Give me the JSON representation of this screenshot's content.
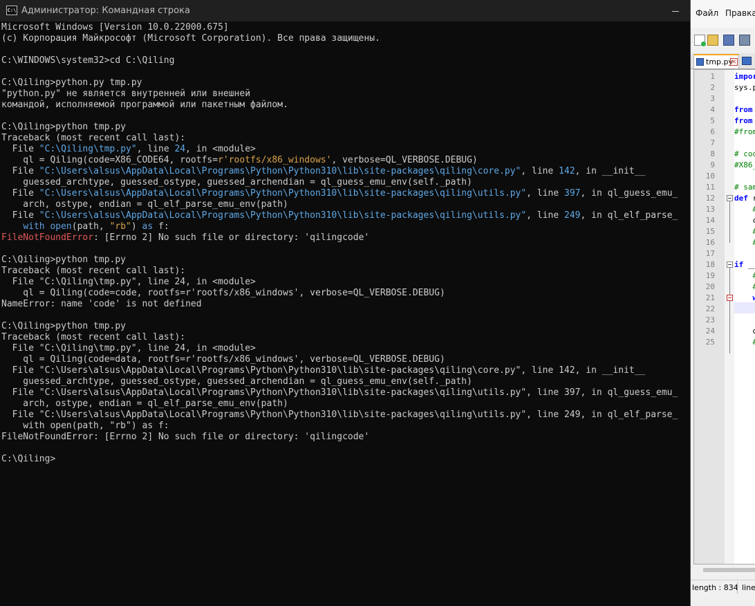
{
  "cmd": {
    "title": "Администратор: Командная строка",
    "icon": "cmd-icon",
    "lines": [
      [
        {
          "t": "Microsoft Windows [Version 10.0.22000.675]",
          "c": ""
        }
      ],
      [
        {
          "t": "(c) Корпорация Майкрософт (Microsoft Corporation). Все права защищены.",
          "c": ""
        }
      ],
      [],
      [
        {
          "t": "C:\\WINDOWS\\system32>cd C:\\Qiling",
          "c": ""
        }
      ],
      [],
      [
        {
          "t": "C:\\Qiling>python.py tmp.py",
          "c": ""
        }
      ],
      [
        {
          "t": "\"python.py\" не является внутренней или внешней",
          "c": ""
        }
      ],
      [
        {
          "t": "командой, исполняемой программой или пакетным файлом.",
          "c": ""
        }
      ],
      [],
      [
        {
          "t": "C:\\Qiling>python tmp.py",
          "c": ""
        }
      ],
      [
        {
          "t": "Traceback (most recent call last):",
          "c": ""
        }
      ],
      [
        {
          "t": "  File ",
          "c": ""
        },
        {
          "t": "\"C:\\Qiling\\tmp.py\"",
          "c": "p"
        },
        {
          "t": ", line ",
          "c": ""
        },
        {
          "t": "24",
          "c": "n"
        },
        {
          "t": ", in <module>",
          "c": ""
        }
      ],
      [
        {
          "t": "    ql = Qiling(code=X86_CODE64, rootfs=",
          "c": ""
        },
        {
          "t": "r'rootfs/x86_windows'",
          "c": "s"
        },
        {
          "t": ", verbose=QL_VERBOSE.DEBUG)",
          "c": ""
        }
      ],
      [
        {
          "t": "  File ",
          "c": ""
        },
        {
          "t": "\"C:\\Users\\alsus\\AppData\\Local\\Programs\\Python\\Python310\\lib\\site-packages\\qiling\\core.py\"",
          "c": "p"
        },
        {
          "t": ", line ",
          "c": ""
        },
        {
          "t": "142",
          "c": "n"
        },
        {
          "t": ", in __init__",
          "c": ""
        }
      ],
      [
        {
          "t": "    guessed_archtype, guessed_ostype, guessed_archendian = ql_guess_emu_env(self._path)",
          "c": ""
        }
      ],
      [
        {
          "t": "  File ",
          "c": ""
        },
        {
          "t": "\"C:\\Users\\alsus\\AppData\\Local\\Programs\\Python\\Python310\\lib\\site-packages\\qiling\\utils.py\"",
          "c": "p"
        },
        {
          "t": ", line ",
          "c": ""
        },
        {
          "t": "397",
          "c": "n"
        },
        {
          "t": ", in ql_guess_emu_",
          "c": ""
        }
      ],
      [
        {
          "t": "    arch, ostype, endian = ql_elf_parse_emu_env(path)",
          "c": ""
        }
      ],
      [
        {
          "t": "  File ",
          "c": ""
        },
        {
          "t": "\"C:\\Users\\alsus\\AppData\\Local\\Programs\\Python\\Python310\\lib\\site-packages\\qiling\\utils.py\"",
          "c": "p"
        },
        {
          "t": ", line ",
          "c": ""
        },
        {
          "t": "249",
          "c": "n"
        },
        {
          "t": ", in ql_elf_parse_",
          "c": ""
        }
      ],
      [
        {
          "t": "    ",
          "c": ""
        },
        {
          "t": "with",
          "c": "k"
        },
        {
          "t": " ",
          "c": ""
        },
        {
          "t": "open",
          "c": "k"
        },
        {
          "t": "(path, ",
          "c": ""
        },
        {
          "t": "\"rb\"",
          "c": "s"
        },
        {
          "t": ") ",
          "c": ""
        },
        {
          "t": "as",
          "c": "k"
        },
        {
          "t": " f:",
          "c": ""
        }
      ],
      [
        {
          "t": "FileNotFoundError",
          "c": "e"
        },
        {
          "t": ": [Errno 2] No such file or directory: 'qilingcode'",
          "c": ""
        }
      ],
      [],
      [
        {
          "t": "C:\\Qiling>python tmp.py",
          "c": ""
        }
      ],
      [
        {
          "t": "Traceback (most recent call last):",
          "c": ""
        }
      ],
      [
        {
          "t": "  File \"C:\\Qiling\\tmp.py\", line 24, in <module>",
          "c": ""
        }
      ],
      [
        {
          "t": "    ql = Qiling(code=code, rootfs=r'rootfs/x86_windows', verbose=QL_VERBOSE.DEBUG)",
          "c": ""
        }
      ],
      [
        {
          "t": "NameError: name 'code' is not defined",
          "c": ""
        }
      ],
      [],
      [
        {
          "t": "C:\\Qiling>python tmp.py",
          "c": ""
        }
      ],
      [
        {
          "t": "Traceback (most recent call last):",
          "c": ""
        }
      ],
      [
        {
          "t": "  File \"C:\\Qiling\\tmp.py\", line 24, in <module>",
          "c": ""
        }
      ],
      [
        {
          "t": "    ql = Qiling(code=data, rootfs=r'rootfs/x86_windows', verbose=QL_VERBOSE.DEBUG)",
          "c": ""
        }
      ],
      [
        {
          "t": "  File \"C:\\Users\\alsus\\AppData\\Local\\Programs\\Python\\Python310\\lib\\site-packages\\qiling\\core.py\", line 142, in __init__",
          "c": ""
        }
      ],
      [
        {
          "t": "    guessed_archtype, guessed_ostype, guessed_archendian = ql_guess_emu_env(self._path)",
          "c": ""
        }
      ],
      [
        {
          "t": "  File \"C:\\Users\\alsus\\AppData\\Local\\Programs\\Python\\Python310\\lib\\site-packages\\qiling\\utils.py\", line 397, in ql_guess_emu_",
          "c": ""
        }
      ],
      [
        {
          "t": "    arch, ostype, endian = ql_elf_parse_emu_env(path)",
          "c": ""
        }
      ],
      [
        {
          "t": "  File \"C:\\Users\\alsus\\AppData\\Local\\Programs\\Python\\Python310\\lib\\site-packages\\qiling\\utils.py\", line 249, in ql_elf_parse_",
          "c": ""
        }
      ],
      [
        {
          "t": "    with open(path, \"rb\") as f:",
          "c": ""
        }
      ],
      [
        {
          "t": "FileNotFoundError: [Errno 2] No such file or directory: 'qilingcode'",
          "c": ""
        }
      ],
      [],
      [
        {
          "t": "C:\\Qiling>",
          "c": ""
        }
      ]
    ]
  },
  "npp": {
    "menu": [
      "Файл",
      "Правка"
    ],
    "toolbar_icons": [
      "new-file-icon",
      "open-file-icon",
      "save-icon",
      "save-all-icon"
    ],
    "tab": {
      "label": "tmp.py",
      "icon": "save-icon",
      "close": "×"
    },
    "editor": {
      "lines": [
        {
          "n": "1",
          "parts": [
            {
              "t": "impor",
              "c": "kw"
            }
          ]
        },
        {
          "n": "2",
          "parts": [
            {
              "t": "sys.p",
              "c": "pl"
            }
          ]
        },
        {
          "n": "3",
          "parts": []
        },
        {
          "n": "4",
          "parts": [
            {
              "t": "from",
              "c": "kw"
            }
          ]
        },
        {
          "n": "5",
          "parts": [
            {
              "t": "from",
              "c": "kw"
            }
          ]
        },
        {
          "n": "6",
          "parts": [
            {
              "t": "#from",
              "c": "cm"
            }
          ]
        },
        {
          "n": "7",
          "parts": []
        },
        {
          "n": "8",
          "parts": [
            {
              "t": "# coo",
              "c": "cm"
            }
          ]
        },
        {
          "n": "9",
          "parts": [
            {
              "t": "#X86_",
              "c": "cm"
            }
          ]
        },
        {
          "n": "10",
          "parts": []
        },
        {
          "n": "11",
          "parts": [
            {
              "t": "# sam",
              "c": "cm"
            }
          ]
        },
        {
          "n": "12",
          "parts": [
            {
              "t": "def ",
              "c": "kw"
            },
            {
              "t": "r",
              "c": "pl"
            }
          ]
        },
        {
          "n": "13",
          "parts": [
            {
              "t": "    #",
              "c": "cm"
            }
          ]
        },
        {
          "n": "14",
          "parts": [
            {
              "t": "    c",
              "c": "pl"
            }
          ]
        },
        {
          "n": "15",
          "parts": [
            {
              "t": "    #",
              "c": "cm"
            }
          ]
        },
        {
          "n": "16",
          "parts": [
            {
              "t": "    #",
              "c": "cm"
            }
          ]
        },
        {
          "n": "17",
          "parts": []
        },
        {
          "n": "18",
          "parts": [
            {
              "t": "if ",
              "c": "kw"
            },
            {
              "t": "__",
              "c": "pl"
            }
          ]
        },
        {
          "n": "19",
          "parts": [
            {
              "t": "    #",
              "c": "cm"
            }
          ]
        },
        {
          "n": "20",
          "parts": [
            {
              "t": "    #",
              "c": "cm"
            }
          ]
        },
        {
          "n": "21",
          "parts": [
            {
              "t": "    w",
              "c": "kw"
            }
          ]
        },
        {
          "n": "22",
          "parts": []
        },
        {
          "n": "23",
          "parts": []
        },
        {
          "n": "24",
          "parts": [
            {
              "t": "    q",
              "c": "pl"
            }
          ]
        },
        {
          "n": "25",
          "parts": [
            {
              "t": "    #",
              "c": "cm"
            }
          ]
        }
      ]
    },
    "status": {
      "length": "length : 834",
      "line": "line"
    }
  }
}
